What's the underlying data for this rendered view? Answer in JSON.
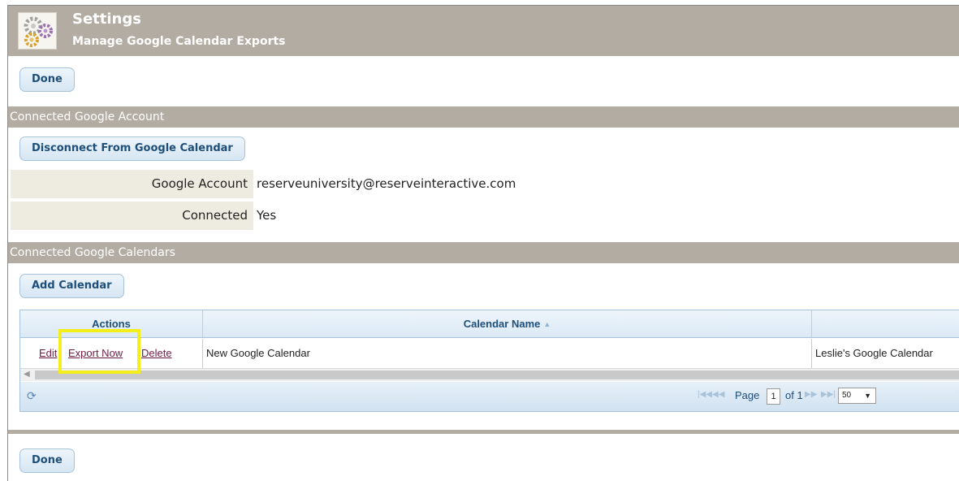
{
  "header": {
    "title": "Settings",
    "subtitle": "Manage Google Calendar Exports",
    "logo_icon": "gears-icon"
  },
  "top_done_label": "Done",
  "account_section": {
    "title": "Connected Google Account",
    "disconnect_label": "Disconnect From Google Calendar",
    "rows": [
      {
        "label": "Google Account",
        "value": "reserveuniversity@reserveinteractive.com"
      },
      {
        "label": "Connected",
        "value": "Yes"
      }
    ]
  },
  "calendars_section": {
    "title": "Connected Google Calendars",
    "add_label": "Add Calendar"
  },
  "grid": {
    "columns": [
      "Actions",
      "Calendar Name",
      ""
    ],
    "sort_icon": "sort-arrows-icon",
    "rows": [
      {
        "actions": [
          "Edit",
          "Export Now",
          "Delete"
        ],
        "calendar_name": "New Google Calendar",
        "owner": "Leslie's Google Calendar"
      }
    ],
    "highlight_color": "#f4ee1a"
  },
  "pager": {
    "refresh_icon": "refresh-icon",
    "page_label": "Page",
    "page_value": "1",
    "of_label": "of 1",
    "page_size": "50"
  },
  "bottom_done_label": "Done",
  "colors": {
    "section_bar": "#b3aca3",
    "button_text": "#1e4f7a",
    "link": "#6d1c45"
  }
}
